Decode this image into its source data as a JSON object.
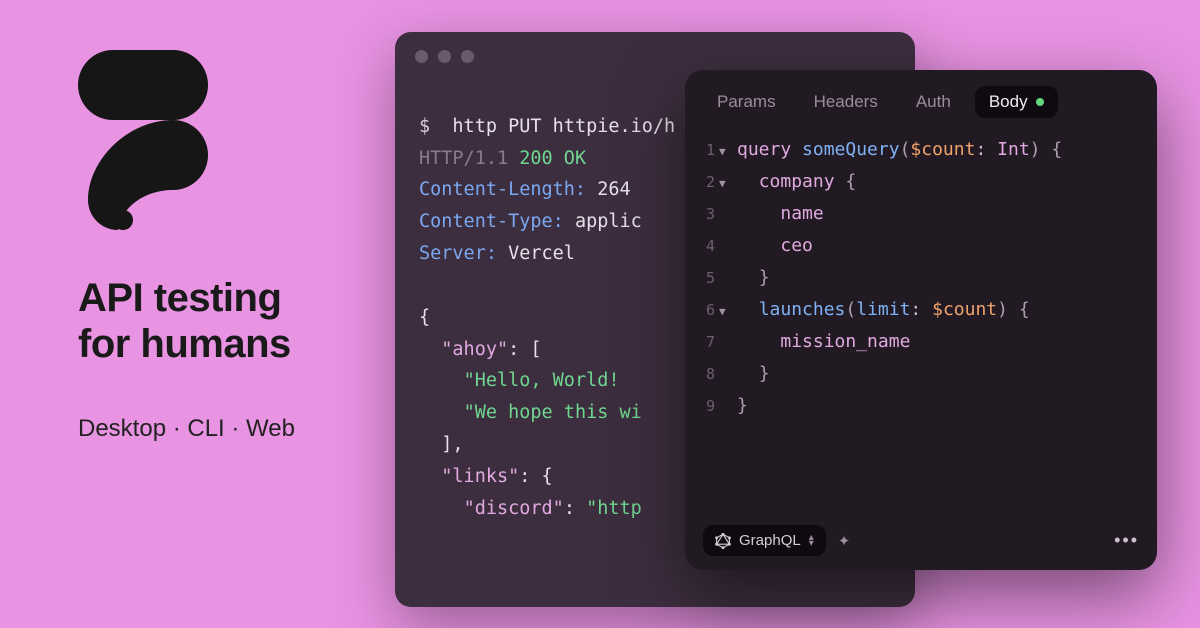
{
  "left": {
    "tagline_l1": "API testing",
    "tagline_l2": "for humans",
    "platforms": "Desktop · CLI · Web"
  },
  "terminal": {
    "prompt": "$",
    "cmd": "http PUT httpie.io/h",
    "proto": "HTTP/1.1",
    "status": "200 OK",
    "hdr1_k": "Content-Length:",
    "hdr1_v": "264",
    "hdr2_k": "Content-Type:",
    "hdr2_v": "applic",
    "hdr3_k": "Server:",
    "hdr3_v": "Vercel",
    "json_open": "{",
    "json_k1": "\"ahoy\"",
    "json_k1_after": ": [",
    "json_v1": "\"Hello, World! ",
    "json_v2": "\"We hope this wi",
    "json_arr_close": "],",
    "json_k2": "\"links\"",
    "json_k2_after": ": {",
    "json_k3": "\"discord\"",
    "json_k3_after": ": ",
    "json_v3": "\"http"
  },
  "editor": {
    "tabs": {
      "params": "Params",
      "headers": "Headers",
      "auth": "Auth",
      "body": "Body"
    },
    "lines": {
      "l1": {
        "n": "1",
        "fold": "▼",
        "kw": "query",
        "fn": "someQuery",
        "paren_open": "(",
        "var": "$count",
        "colon": ": ",
        "type": "Int",
        "paren_close": ")",
        "brace": " {"
      },
      "l2": {
        "n": "2",
        "fold": "▼",
        "indent": "  ",
        "field": "company",
        "brace": " {"
      },
      "l3": {
        "n": "3",
        "indent": "    ",
        "field": "name"
      },
      "l4": {
        "n": "4",
        "indent": "    ",
        "field": "ceo"
      },
      "l5": {
        "n": "5",
        "indent": "  ",
        "brace": "}"
      },
      "l6": {
        "n": "6",
        "fold": "▼",
        "indent": "  ",
        "fn": "launches",
        "paren_open": "(",
        "arg": "limit",
        "colon": ": ",
        "var": "$count",
        "paren_close": ")",
        "brace": " {"
      },
      "l7": {
        "n": "7",
        "indent": "    ",
        "field": "mission_name"
      },
      "l8": {
        "n": "8",
        "indent": "  ",
        "brace": "}"
      },
      "l9": {
        "n": "9",
        "brace": "}"
      }
    },
    "footer": {
      "lang": "GraphQL",
      "more": "•••"
    }
  }
}
